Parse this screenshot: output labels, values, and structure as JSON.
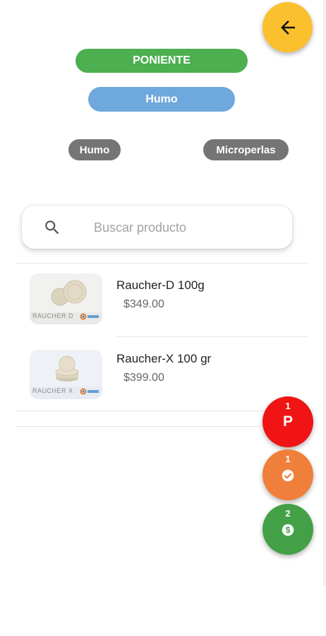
{
  "header": {
    "back_icon": "arrow-left-icon",
    "back_color": "#fbc02d"
  },
  "zone": {
    "label": "PONIENTE",
    "color": "#4caf50"
  },
  "category": {
    "label": "Humo",
    "color": "#6fa8dc"
  },
  "filters": [
    {
      "label": "Humo"
    },
    {
      "label": "Microperlas"
    }
  ],
  "search": {
    "placeholder": "Buscar producto",
    "value": "",
    "icon": "search-icon"
  },
  "products": [
    {
      "name": "Raucher-D 100g",
      "price": "$349.00",
      "image_caption": "RAUCHER D"
    },
    {
      "name": "Raucher-X 100 gr",
      "price": "$399.00",
      "image_caption": "RAUCHER X"
    }
  ],
  "fabs": [
    {
      "count": "1",
      "label": "P",
      "color": "#f01414"
    },
    {
      "count": "1",
      "icon": "check-badge-icon",
      "color": "#ef7f3b"
    },
    {
      "count": "2",
      "icon": "dollar-circle-icon",
      "color": "#43a047"
    }
  ]
}
